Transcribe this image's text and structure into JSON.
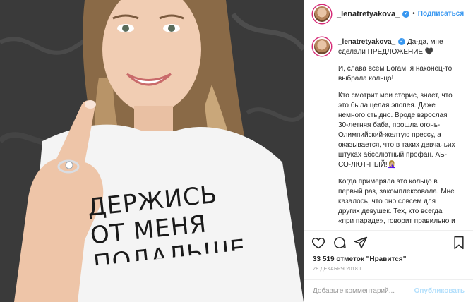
{
  "post": {
    "username": "_lenatretyakova_",
    "verified_icon": "verified-badge-icon",
    "follow_label": "Подписаться",
    "dot": "•",
    "caption_lead": "Да-да, мне сделали ПРЕДЛОЖЕНИЕ!🖤",
    "paragraphs": [
      "И, слава всем Богам, я наконец-то выбрала кольцо!",
      "Кто смотрит мои сторис, знает, что это была целая эпопея. Даже немного стыдно. Вроде взрослая 30-летняя баба, прошла огонь-Олимпийский-желтую прессу, а оказывается, что в таких девчачьих штуках абсолютный профан. АБ-СО-ЛЮТ-НЫЙ!🤦🏼‍♀️",
      "Когда примеряла это кольцо в первый раз, закомплексовала. Мне казалось, что оно совсем для других девушек. Тех, кто всегда «при параде», говорит правильно и"
    ],
    "likes": "33 519 отметок \"Нравится\"",
    "date": "28 ДЕКАБРЯ 2018 Г.",
    "comment_placeholder": "Добавьте комментарий...",
    "publish_label": "Опубликовать"
  },
  "photo": {
    "shirt_text": [
      "ДЕРЖИСЬ",
      "ОТ МЕНЯ",
      "ПОДАЛЬШЕ"
    ]
  },
  "colors": {
    "link": "#3897f0",
    "publish_disabled": "#b2dffc",
    "text": "#262626",
    "muted": "#999999"
  }
}
